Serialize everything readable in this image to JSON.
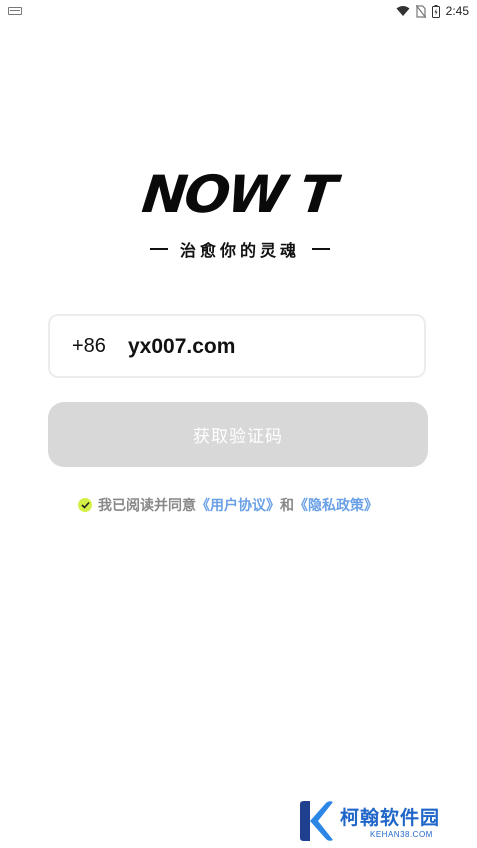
{
  "status_bar": {
    "time": "2:45",
    "icons": [
      "notification-icon",
      "wifi-icon",
      "no-sim-icon",
      "battery-icon"
    ]
  },
  "brand": {
    "logo_text": "NOW T",
    "tagline": "治愈你的灵魂"
  },
  "login": {
    "country_code": "+86",
    "phone_value": "yx007.com",
    "get_code_label": "获取验证码"
  },
  "agreement": {
    "checked": true,
    "prefix": "我已阅读并同意",
    "user_agreement": "《用户协议》",
    "and": "和",
    "privacy_policy": "《隐私政策》"
  },
  "watermark": {
    "name": "柯翰软件园",
    "domain": "KEHAN38.COM"
  },
  "colors": {
    "button_disabled_bg": "#d8d8d8",
    "link": "#6aa0e6",
    "check": "#d4f046",
    "watermark": "#1f66c8"
  }
}
